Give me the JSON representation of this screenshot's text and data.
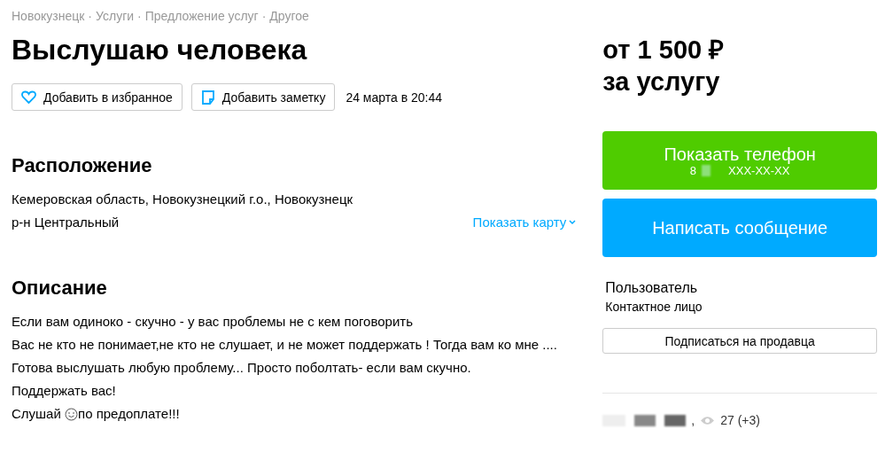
{
  "breadcrumbs": [
    "Новокузнецк",
    "Услуги",
    "Предложение услуг",
    "Другое"
  ],
  "breadcrumb_separator": "·",
  "title": "Выслушаю человека",
  "actions": [
    {
      "kind": "favorite",
      "label": "Добавить в избранное"
    },
    {
      "kind": "note",
      "label": "Добавить заметку"
    }
  ],
  "date": "24 марта в 20:44",
  "location": {
    "heading": "Расположение",
    "address": "Кемеровская область, Новокузнецкий г.о., Новокузнецк",
    "district": "р-н Центральный",
    "map_link": "Показать карту"
  },
  "description": {
    "heading": "Описание",
    "lines": [
      "Если вам одиноко - скучно - у вас проблемы не с кем поговорить",
      "Вас не кто не понимает,не кто не слушает, и не может поддержать ! Тогда вам ко мне ....",
      "Готова выслушать любую проблему... Просто поболтать- если вам скучно.",
      "Поддержать вас!"
    ],
    "closing": {
      "before": "Слушай ",
      "after": "по предоплате!!!"
    }
  },
  "price": {
    "amount": "от 1 500 ₽",
    "unit": "за услугу"
  },
  "phone_button": {
    "label": "Показать телефон",
    "prefix": "8",
    "masked": "XXX-XX-XX"
  },
  "message_button": {
    "label": "Написать сообщение"
  },
  "seller": {
    "name": "Пользователь",
    "role": "Контактное лицо",
    "subscribe": "Подписаться на продавца"
  },
  "stats": {
    "separator": ",",
    "views": "27 (+3)"
  }
}
